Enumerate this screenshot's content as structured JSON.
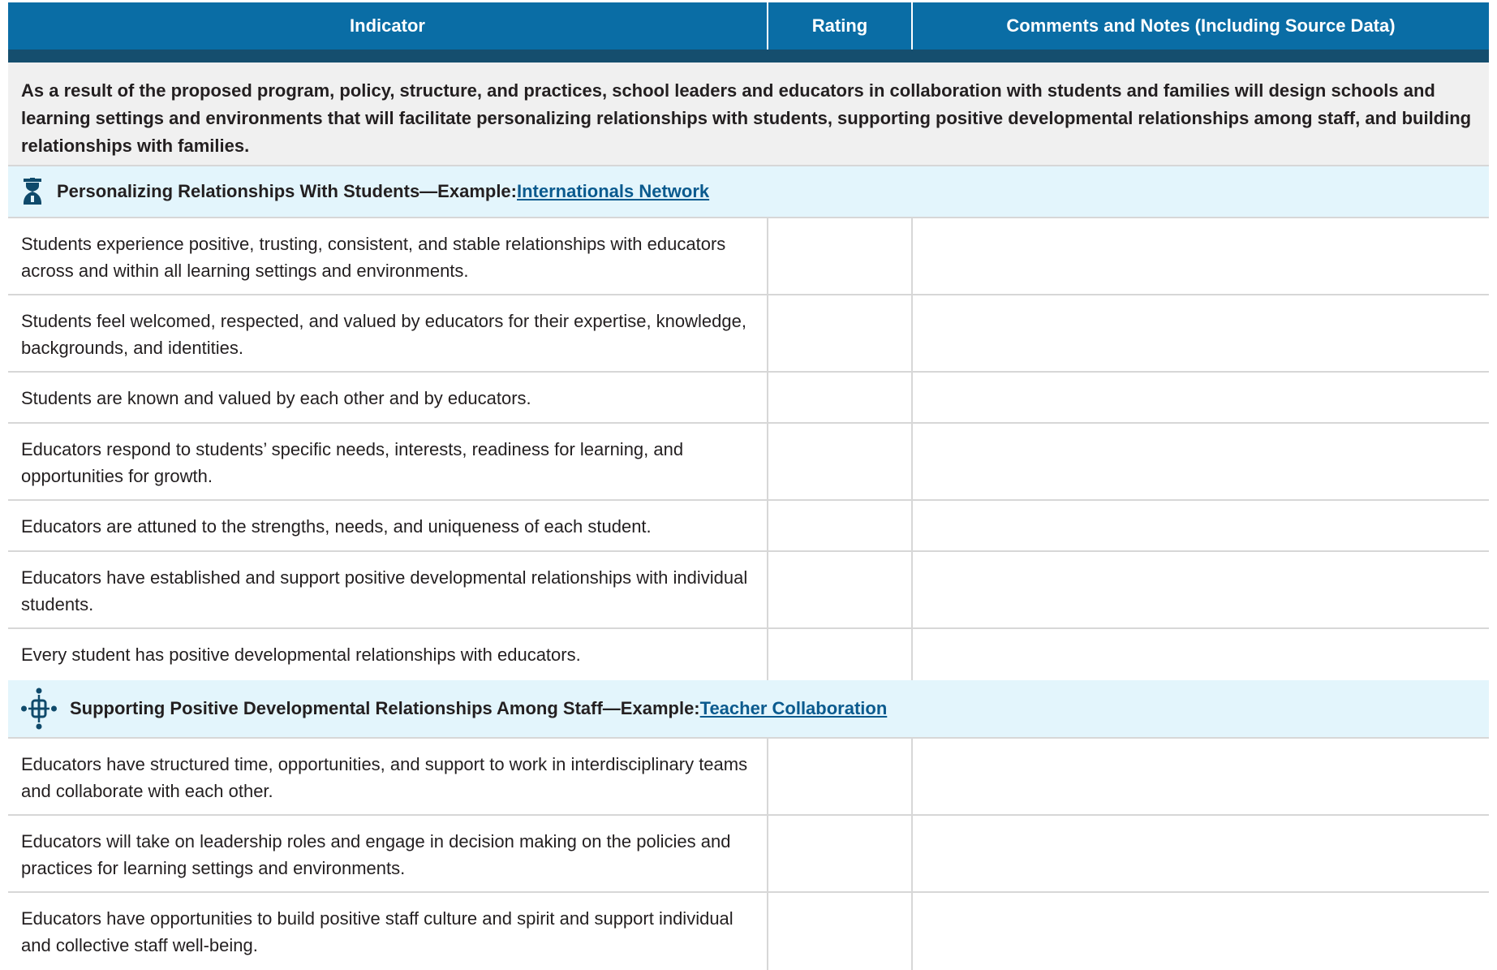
{
  "header": {
    "indicator": "Indicator",
    "rating": "Rating",
    "comments": "Comments and Notes (Including Source Data)"
  },
  "intro": "As a result of the proposed program, policy, structure, and practices, school leaders and educators in collaboration with students and families will design schools and learning settings and environments that will facilitate personalizing relationships with students, supporting positive developmental relationships among staff, and building relationships with families.",
  "sections": [
    {
      "icon": "graduate-icon",
      "title": "Personalizing Relationships With Students—Example: ",
      "link": "Internationals Network",
      "rows": [
        {
          "indicator": "Students experience positive, trusting, consistent, and stable relationships with educators across and within all learning settings and environments.",
          "rating": "",
          "comments": ""
        },
        {
          "indicator": "Students feel welcomed, respected, and valued by educators for their expertise, knowledge, backgrounds, and identities.",
          "rating": "",
          "comments": ""
        },
        {
          "indicator": "Students are known and valued by each other and by educators.",
          "rating": "",
          "comments": ""
        },
        {
          "indicator": "Educators respond to students’ specific needs, interests, readiness for learning, and opportunities for growth.",
          "rating": "",
          "comments": ""
        },
        {
          "indicator": "Educators are attuned to the strengths, needs, and uniqueness of each student.",
          "rating": "",
          "comments": ""
        },
        {
          "indicator": "Educators have established and support positive developmental relationships with individual students.",
          "rating": "",
          "comments": ""
        },
        {
          "indicator": "Every student has positive developmental relationships with educators.",
          "rating": "",
          "comments": ""
        }
      ]
    },
    {
      "icon": "collaboration-icon",
      "title": "Supporting Positive Developmental Relationships Among Staff—Example: ",
      "link": "Teacher Collaboration",
      "rows": [
        {
          "indicator": "Educators have structured time, opportunities, and support to work in interdisciplinary teams and collaborate with each other.",
          "rating": "",
          "comments": ""
        },
        {
          "indicator": "Educators will take on leadership roles and engage in decision making on the policies and practices for learning settings and environments.",
          "rating": "",
          "comments": ""
        },
        {
          "indicator": "Educators have opportunities to build positive staff culture and spirit and support individual and collective staff well-being.",
          "rating": "",
          "comments": ""
        }
      ]
    }
  ],
  "colors": {
    "header_bg": "#0a6da5",
    "header_bar": "#154e6e",
    "intro_bg": "#f0f0f0",
    "section_bg": "#e3f5fc",
    "link": "#0a5a8e",
    "rule": "#d7d7d7"
  }
}
